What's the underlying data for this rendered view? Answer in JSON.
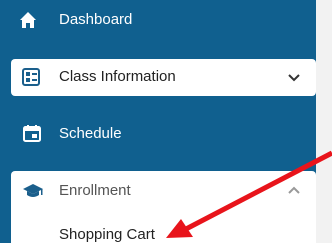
{
  "nav": {
    "dashboard": {
      "label": "Dashboard",
      "icon": "home-icon"
    },
    "class_information": {
      "label": "Class Information",
      "icon": "class-info-icon",
      "chevron": "chevron-down-icon"
    },
    "schedule": {
      "label": "Schedule",
      "icon": "calendar-icon"
    },
    "enrollment": {
      "label": "Enrollment",
      "icon": "graduation-cap-icon",
      "chevron": "chevron-up-icon",
      "subitems": [
        {
          "label": "Shopping Cart"
        }
      ]
    }
  },
  "annotation": {
    "type": "red-arrow",
    "color": "#e8141b",
    "points_to": "Shopping Cart"
  },
  "colors": {
    "sidebar_bg": "#10608f",
    "card_bg": "#ffffff",
    "arrow": "#e8141b"
  }
}
